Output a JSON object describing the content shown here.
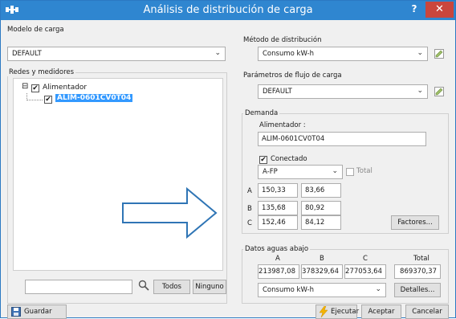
{
  "window": {
    "title": "Análisis de distribución de carga",
    "help": "?",
    "close": "✕"
  },
  "load_model": {
    "label": "Modelo de carga",
    "value": "DEFAULT"
  },
  "networks": {
    "label": "Redes y medidores",
    "root": {
      "expander": "⊟",
      "label": "Alimentador",
      "checked": true
    },
    "child": {
      "label": "ALIM-0601CV0T04",
      "checked": true
    }
  },
  "search": {
    "value": "",
    "placeholder": ""
  },
  "buttons": {
    "todos": "Todos",
    "ninguno": "Ninguno",
    "guardar": "Guardar",
    "ejecutar": "Ejecutar",
    "aceptar": "Aceptar",
    "cancelar": "Cancelar",
    "factores": "Factores...",
    "detalles": "Detalles..."
  },
  "distribution_method": {
    "label": "Método de distribución",
    "value": "Consumo kW-h"
  },
  "flow_params": {
    "label": "Parámetros de flujo de carga",
    "value": "DEFAULT"
  },
  "demand": {
    "label": "Demanda",
    "feeder_label": "Alimentador :",
    "feeder_value": "ALIM-0601CV0T04",
    "connected_label": "Conectado",
    "connected": true,
    "unit": "A-FP",
    "total_label": "Total",
    "total_checked": false,
    "phases": [
      {
        "name": "A",
        "v1": "150,33",
        "v2": "83,66"
      },
      {
        "name": "B",
        "v1": "135,68",
        "v2": "80,92"
      },
      {
        "name": "C",
        "v1": "152,46",
        "v2": "84,12"
      }
    ]
  },
  "downstream": {
    "label": "Datos aguas abajo",
    "headers": [
      "A",
      "B",
      "C",
      "Total"
    ],
    "values": [
      "213987,08",
      "378329,64",
      "277053,64",
      "869370,37"
    ],
    "unit": "Consumo kW-h"
  },
  "colors": {
    "titlebar": "#2f86d0",
    "close": "#c9463d",
    "selection": "#3399ff",
    "arrow": "#2f75b5"
  }
}
